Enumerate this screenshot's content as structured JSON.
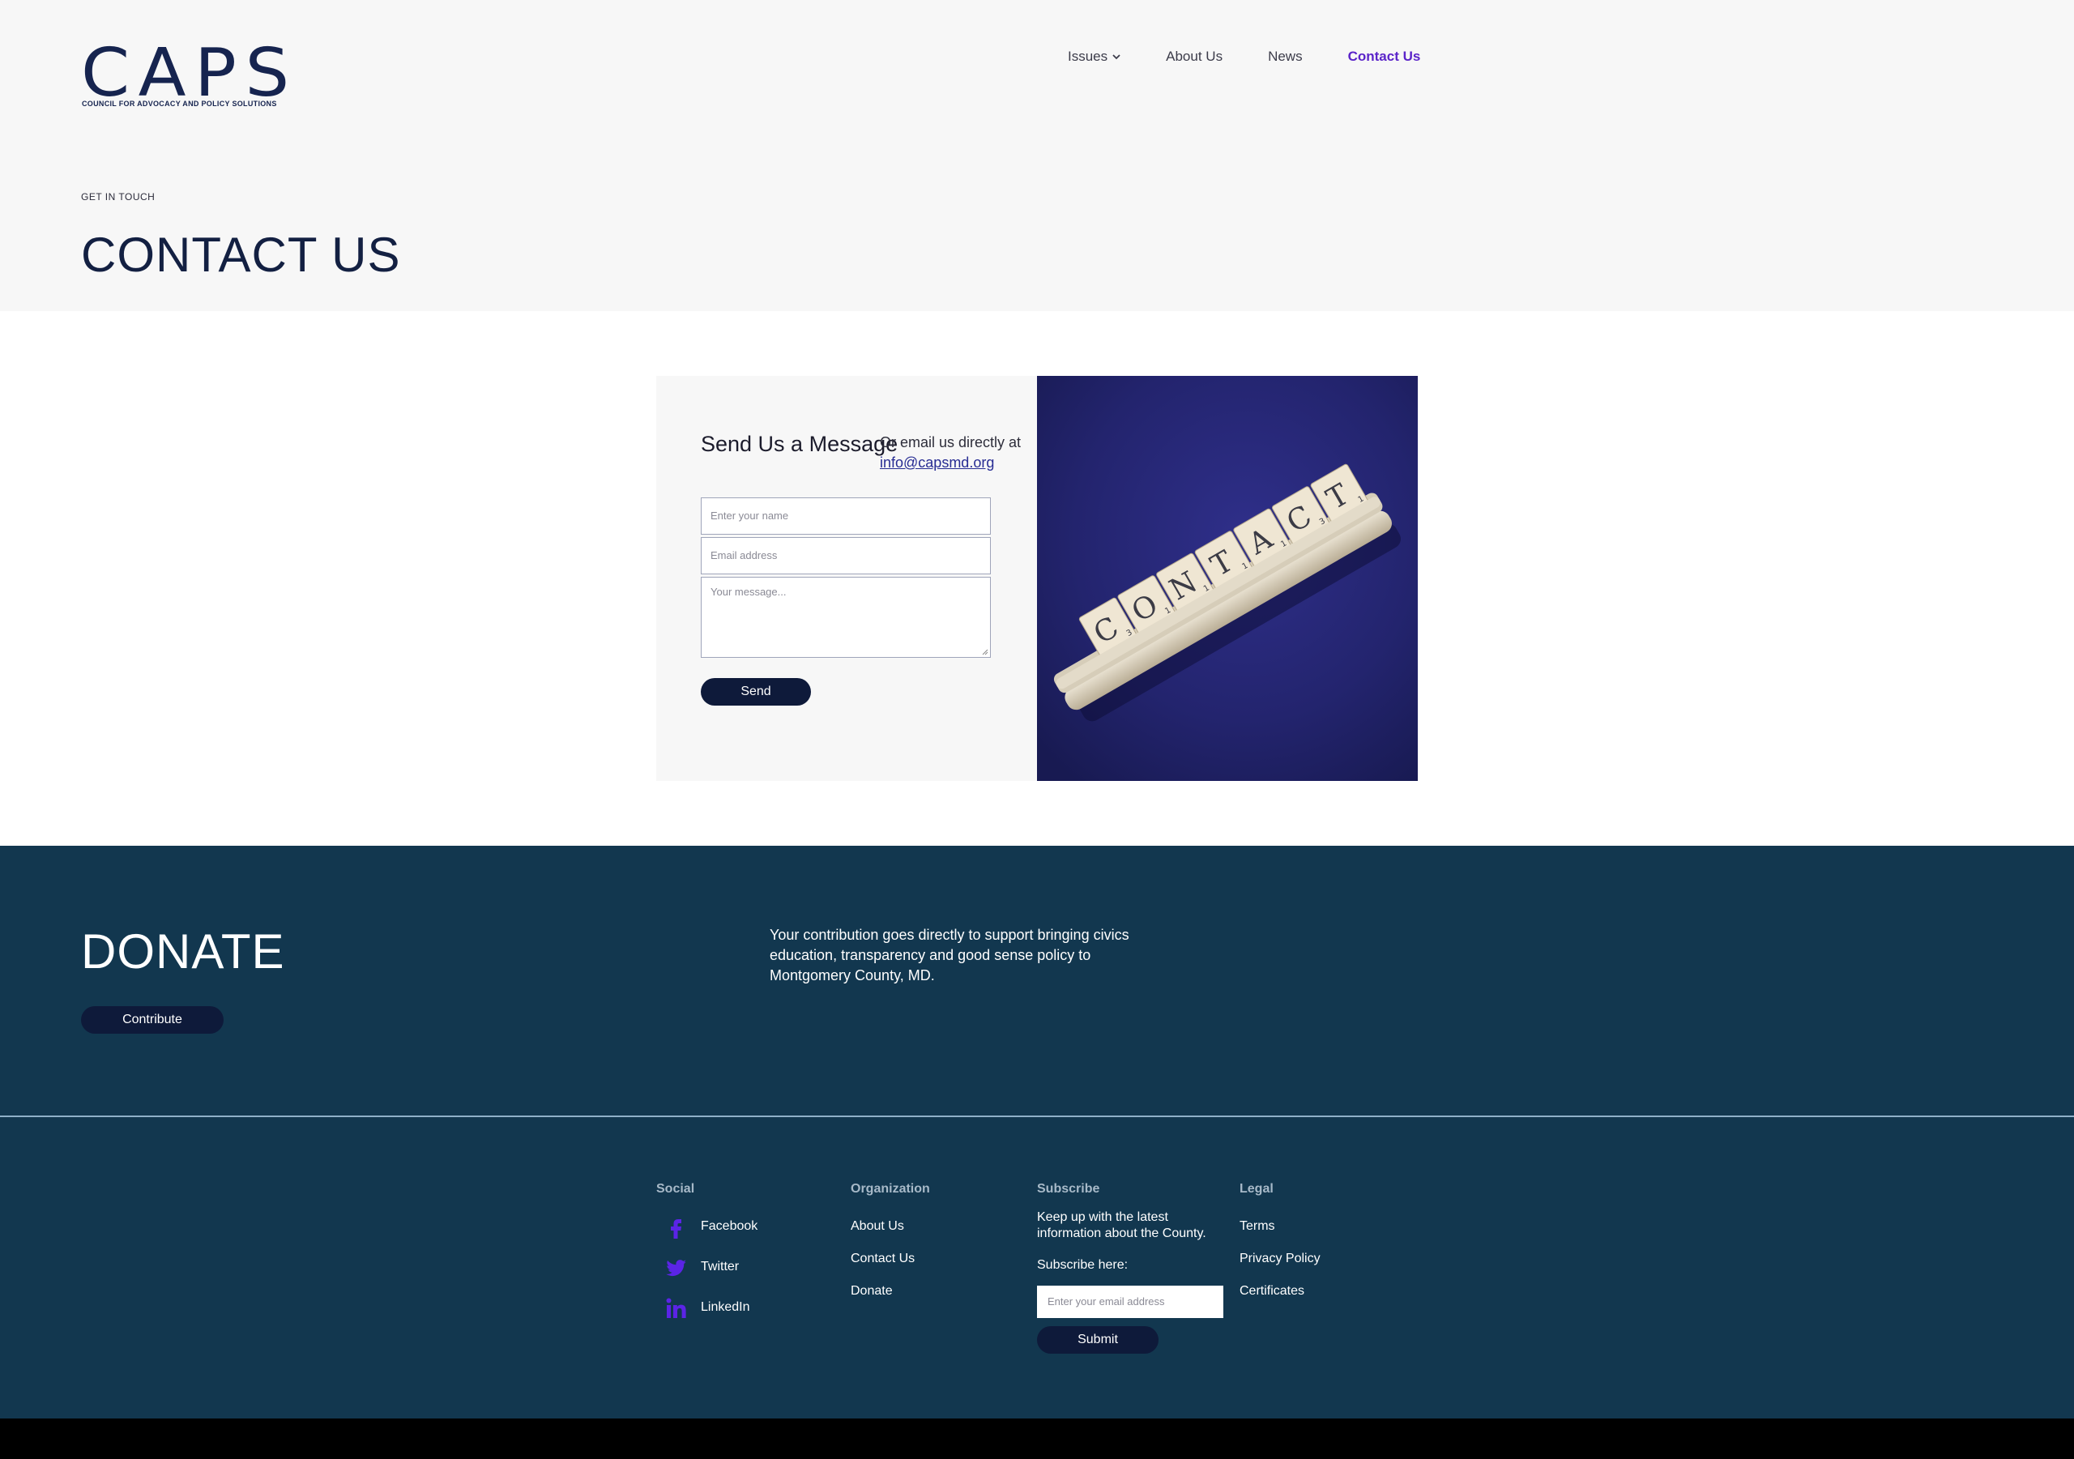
{
  "brand": {
    "name": "CAPS",
    "tagline": "COUNCIL FOR ADVOCACY AND POLICY SOLUTIONS",
    "color": "#16244f"
  },
  "nav": {
    "items": [
      {
        "label": "Issues",
        "has_dropdown": true,
        "active": false
      },
      {
        "label": "About Us",
        "active": false
      },
      {
        "label": "News",
        "active": false
      },
      {
        "label": "Contact Us",
        "active": true
      }
    ],
    "active_color": "#5b24c9"
  },
  "hero": {
    "eyebrow": "GET IN TOUCH",
    "title": "CONTACT US"
  },
  "contact_form": {
    "heading": "Send Us a Message",
    "email_prefix": "Or email us directly at",
    "email": "info@capsmd.org",
    "name_placeholder": "Enter your name",
    "email_placeholder": "Email address",
    "message_placeholder": "Your message...",
    "send_label": "Send",
    "image": {
      "tiles": [
        "C",
        "O",
        "N",
        "T",
        "A",
        "C",
        "T"
      ],
      "subscripts": [
        "3",
        "1",
        "1",
        "1",
        "1",
        "3",
        "1"
      ],
      "background": "#23246e"
    }
  },
  "donate": {
    "title": "DONATE",
    "button_label": "Contribute",
    "text": "Your contribution goes directly to support bringing civics education, transparency and good sense policy to Montgomery County, MD.",
    "background": "#12374f"
  },
  "footer": {
    "social": {
      "title": "Social",
      "items": [
        {
          "label": "Facebook",
          "icon": "facebook-icon"
        },
        {
          "label": "Twitter",
          "icon": "twitter-icon"
        },
        {
          "label": "LinkedIn",
          "icon": "linkedin-icon"
        }
      ],
      "icon_color": "#5b24e6"
    },
    "organization": {
      "title": "Organization",
      "items": [
        "About Us",
        "Contact Us",
        "Donate"
      ]
    },
    "subscribe": {
      "title": "Subscribe",
      "text": "Keep up with the latest information about the County.",
      "label": "Subscribe here:",
      "placeholder": "Enter your email address",
      "button_label": "Submit"
    },
    "legal": {
      "title": "Legal",
      "items": [
        "Terms",
        "Privacy Policy",
        "Certificates"
      ]
    }
  }
}
